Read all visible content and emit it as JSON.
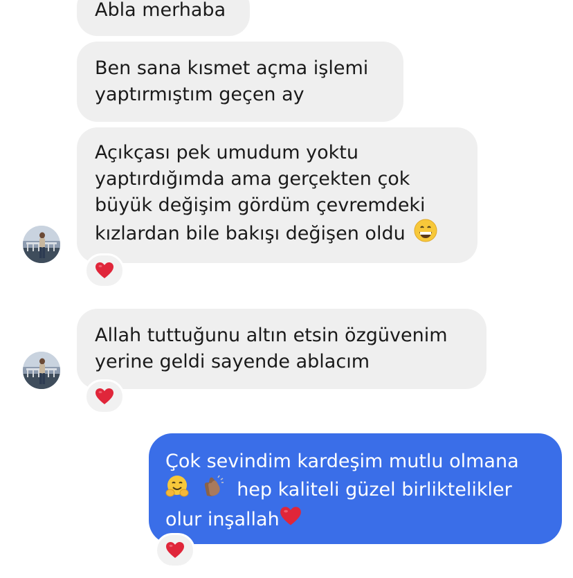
{
  "messages": [
    {
      "id": "m1",
      "direction": "incoming",
      "lines": [
        "Abla merhaba"
      ],
      "reaction": null
    },
    {
      "id": "m2",
      "direction": "incoming",
      "lines": [
        "Ben sana kısmet açma işlemi",
        "yaptırmıştım geçen ay"
      ],
      "reaction": null
    },
    {
      "id": "m3",
      "direction": "incoming",
      "lines": [
        "Açıkçası pek umudum yoktu",
        "yaptırdığımda ama gerçekten çok",
        "büyük değişim gördüm çevremdeki",
        "kızlardan bile bakışı değişen oldu"
      ],
      "trailing_emoji": "grinning-face",
      "reaction": "red-heart"
    },
    {
      "id": "m4",
      "direction": "incoming",
      "lines": [
        "Allah tuttuğunu altın etsin özgüvenim",
        "yerine geldi sayende ablacım"
      ],
      "reaction": "red-heart"
    },
    {
      "id": "m5",
      "direction": "outgoing",
      "line1": "Çok sevindim kardeşim mutlu olmana",
      "line2_text": "hep kaliteli güzel birliktelikler",
      "line3_text": "olur inşallah",
      "line2_emojis": [
        "hugging-face",
        "clapping-hands"
      ],
      "line3_emoji": "red-heart",
      "reaction": "red-heart"
    }
  ],
  "colors": {
    "incoming_bubble": "#efefef",
    "outgoing_bubble": "#3a6ee8",
    "heart": "#e0263a",
    "reaction_bg": "#f1f1f1"
  }
}
